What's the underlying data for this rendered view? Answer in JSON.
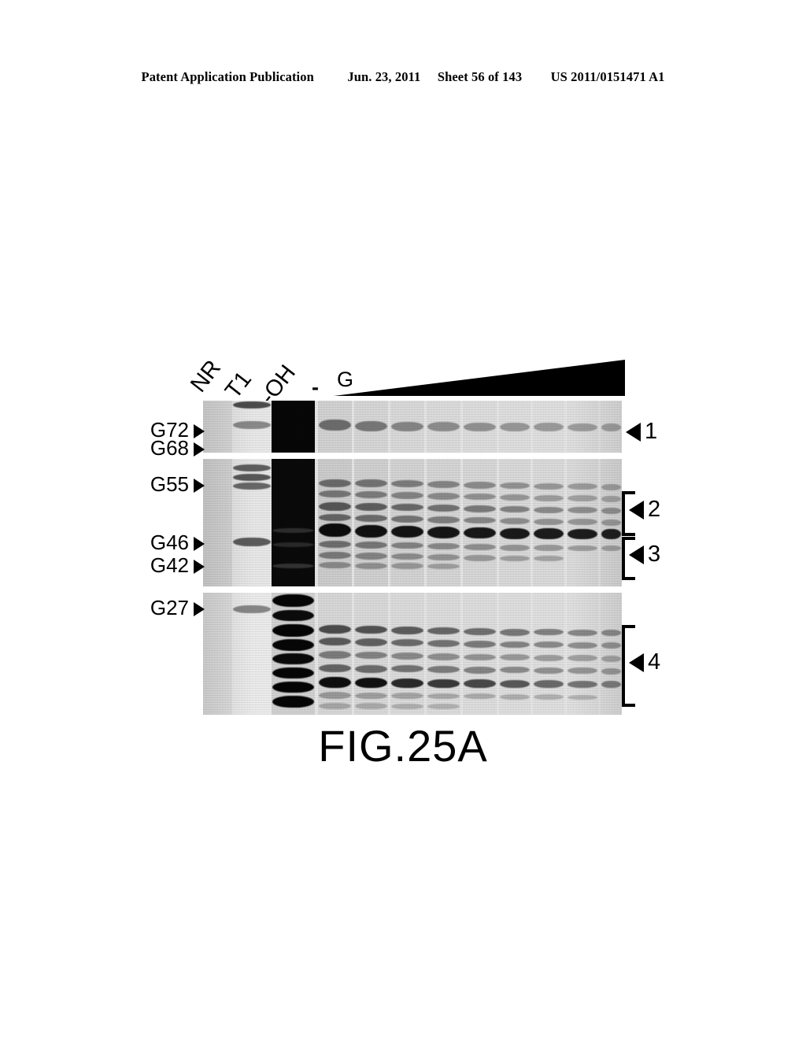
{
  "header": {
    "publication": "Patent Application Publication",
    "date": "Jun. 23, 2011",
    "sheet": "Sheet 56 of 143",
    "patent_number": "US 2011/0151471 A1"
  },
  "figure": {
    "caption": "FIG.25A",
    "lane_labels": [
      "NR",
      "T1",
      "-OH"
    ],
    "minus_label": "-",
    "g_label": "G",
    "left_markers": [
      {
        "label": "G72"
      },
      {
        "label": "G68"
      },
      {
        "label": "G55"
      },
      {
        "label": "G46"
      },
      {
        "label": "G42"
      },
      {
        "label": "G27"
      }
    ],
    "right_markers": [
      {
        "label": "1",
        "bracket": false
      },
      {
        "label": "2",
        "bracket": true
      },
      {
        "label": "3",
        "bracket": true
      },
      {
        "label": "4",
        "bracket": true
      }
    ]
  }
}
